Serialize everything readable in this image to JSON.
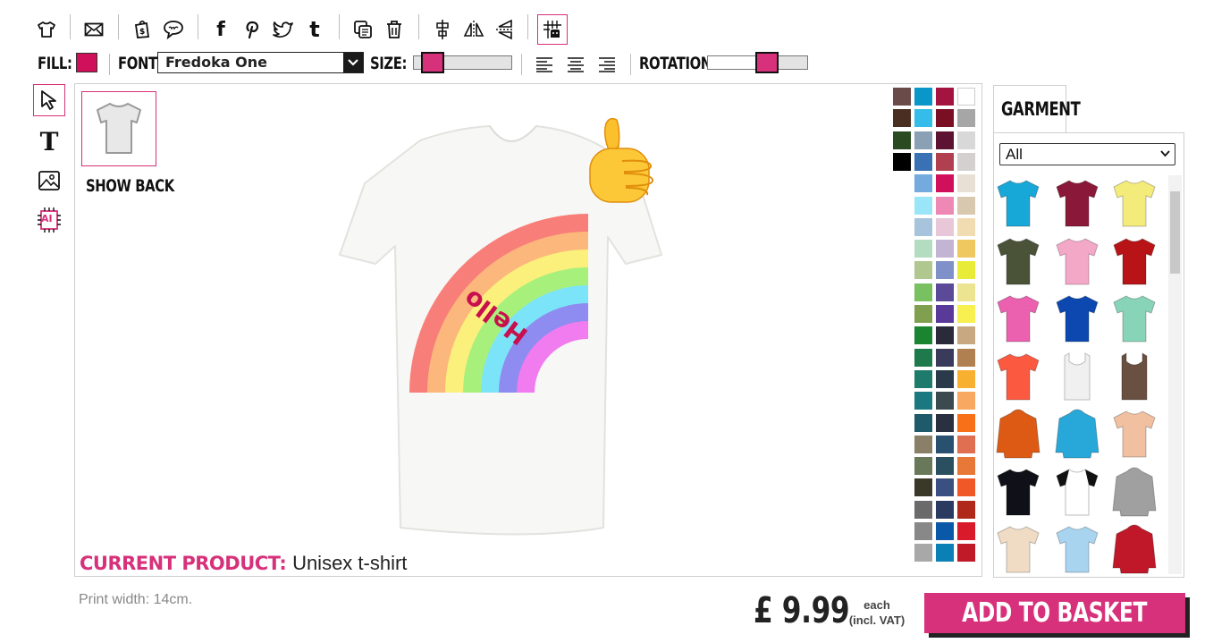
{
  "toolbar": {
    "icons": [
      "tshirt-icon",
      "envelope-icon",
      "shopping-bag-icon",
      "speech-bubble-icon",
      "facebook-icon",
      "pinterest-icon",
      "twitter-icon",
      "tumblr-icon",
      "duplicate-icon",
      "trash-icon",
      "align-center-icon",
      "flip-horizontal-icon",
      "flip-vertical-icon",
      "grid-snap-icon"
    ],
    "social": {
      "facebook": "f",
      "tumblr": "t"
    }
  },
  "properties": {
    "fill_label": "FILL:",
    "fill_color": "#d0105a",
    "font_label": "FONT:",
    "font_value": "Fredoka One",
    "size_label": "SIZE:",
    "size_level": 0.1,
    "rotation_label": "ROTATION:",
    "rotation_level": 0.62
  },
  "left_tools": [
    "pointer-icon",
    "text-icon",
    "image-icon",
    "ai-icon"
  ],
  "left_tools_text": {
    "text": "T",
    "ai": "AI"
  },
  "canvas": {
    "show_back_label": "SHOW BACK",
    "design_text": "Hello",
    "current_product_label": "CURRENT PRODUCT:",
    "current_product_value": "Unisex t-shirt",
    "swatch_colors": [
      [
        "#6b4a4a",
        "#0a96c8",
        "#a31540",
        "#ffffff"
      ],
      [
        "#4a2e22",
        "#35bce8",
        "#7a0e22",
        "#a6a6a6"
      ],
      [
        "#2a4a22",
        "#8aa0b4",
        "#5c1230",
        "#d8d8d8"
      ],
      [
        "#000000",
        "#3a70b4",
        "#b04050",
        "#d4d0d0"
      ],
      [
        null,
        "#74aade",
        "#d0105a",
        "#e8e0d4"
      ],
      [
        null,
        "#9ae6f8",
        "#ee88b4",
        "#d8c8b0"
      ],
      [
        null,
        "#a8c4dc",
        "#e8c8d8",
        "#f0dcb0"
      ],
      [
        null,
        "#b4dcc0",
        "#c4b4d4",
        "#f0c860"
      ],
      [
        null,
        "#b0c890",
        "#8090c8",
        "#e8ec38"
      ],
      [
        null,
        "#78c060",
        "#5a4a98",
        "#ece490"
      ],
      [
        null,
        "#80a050",
        "#5a3a98",
        "#f8f050"
      ],
      [
        null,
        "#1a8430",
        "#2a2a3a",
        "#c8a880"
      ],
      [
        null,
        "#1e7a4a",
        "#3a3a5a",
        "#b08050"
      ],
      [
        null,
        "#1e7a6a",
        "#2a3a4a",
        "#f8b030"
      ],
      [
        null,
        "#1a7880",
        "#3a4a4e",
        "#f8a860"
      ],
      [
        null,
        "#1e5a6a",
        "#2a3040",
        "#f87018"
      ],
      [
        null,
        "#8a8068",
        "#2a5070",
        "#e06e50"
      ],
      [
        null,
        "#6a785a",
        "#2a5060",
        "#e87838"
      ],
      [
        null,
        "#3a3828",
        "#3a5080",
        "#f05828"
      ],
      [
        null,
        "#6a6a6a",
        "#2a3a60",
        "#b0281a"
      ],
      [
        null,
        "#888888",
        "#0a58a8",
        "#d81a2a"
      ],
      [
        null,
        "#a8a8a8",
        "#0a80b4",
        "#c01a28"
      ]
    ]
  },
  "garment_panel": {
    "tab_label": "GARMENT",
    "filter_value": "All",
    "items": [
      {
        "name": "turquoise-tshirt",
        "color": "#18a8d8"
      },
      {
        "name": "maroon-tshirt",
        "color": "#8a1838"
      },
      {
        "name": "yellow-tshirt",
        "color": "#f4ec7a"
      },
      {
        "name": "olive-tshirt",
        "color": "#4a5238"
      },
      {
        "name": "pink-tshirt",
        "color": "#f4a8c8"
      },
      {
        "name": "red-tshirt",
        "color": "#b81418"
      },
      {
        "name": "magenta-tshirt",
        "color": "#ec60b0"
      },
      {
        "name": "royal-blue-tshirt",
        "color": "#0c48b0"
      },
      {
        "name": "mint-tshirt",
        "color": "#88d4b8"
      },
      {
        "name": "coral-tshirt",
        "color": "#fc5a40"
      },
      {
        "name": "white-vest",
        "color": "#f0f0f0"
      },
      {
        "name": "brown-vest",
        "color": "#6a5040"
      },
      {
        "name": "orange-hoodie",
        "color": "#dc5a14"
      },
      {
        "name": "blue-hoodie",
        "color": "#28a8d8"
      },
      {
        "name": "tie-dye-tshirt",
        "color": "#f0c0a0"
      },
      {
        "name": "black-tshirt",
        "color": "#101018"
      },
      {
        "name": "raglan-tshirt",
        "color": "#ffffff"
      },
      {
        "name": "grey-hoodie",
        "color": "#a0a0a0"
      },
      {
        "name": "beige-tshirt",
        "color": "#f0dcc4"
      },
      {
        "name": "light-blue-tshirt",
        "color": "#a8d4f0"
      },
      {
        "name": "varsity-jacket",
        "color": "#c01828"
      }
    ]
  },
  "footer": {
    "print_width": "Print width: 14cm.",
    "price": "£ 9.99",
    "each_line1": "each",
    "each_line2": "(incl. VAT)",
    "add_to_basket": "ADD TO BASKET"
  }
}
